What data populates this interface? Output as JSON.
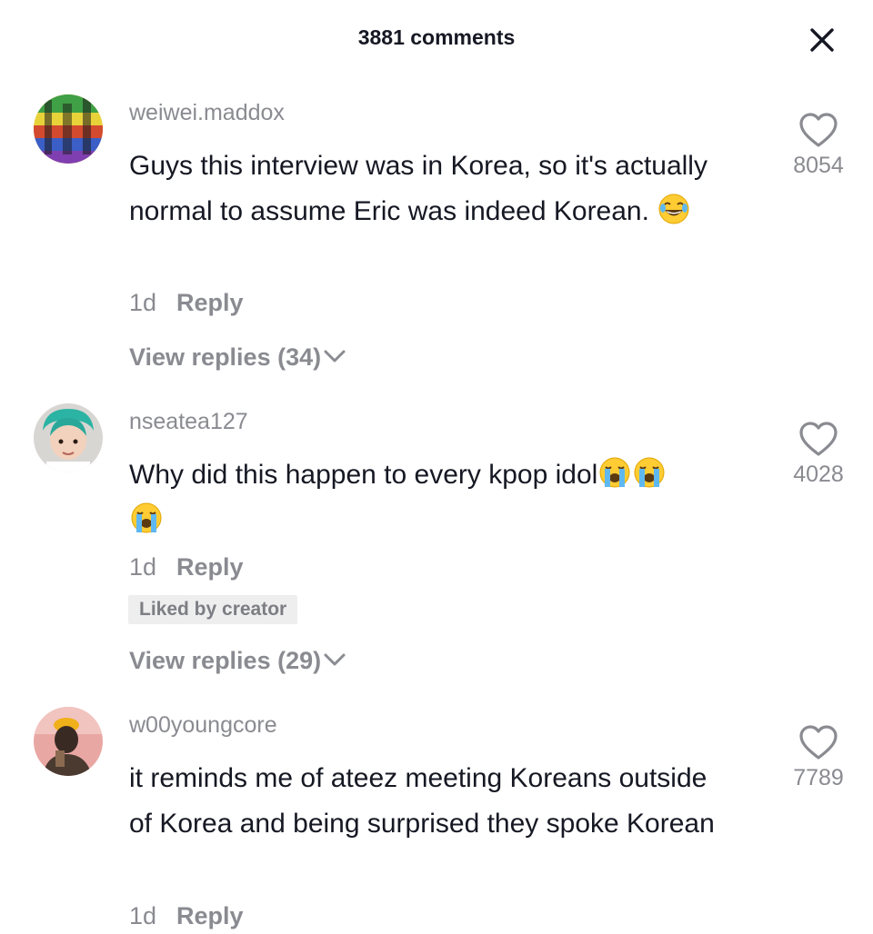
{
  "header": {
    "title": "3881 comments",
    "close_icon": "close-icon"
  },
  "colors": {
    "text_primary": "#161823",
    "text_secondary": "#8a8b91",
    "badge_bg": "#eeeeef"
  },
  "comments": [
    {
      "username": "weiwei.maddox",
      "text_segments": [
        "Guys this interview was in Korea, so it's actually normal to assume Eric was indeed Korean. "
      ],
      "emojis": [
        "tears-of-joy-emoji"
      ],
      "time": "1d",
      "reply_label": "Reply",
      "likes": "8054",
      "view_replies": "View replies (34)"
    },
    {
      "username": "nseatea127",
      "text_segments": [
        "Why did this happen to every kpop idol"
      ],
      "emojis": [
        "loudly-crying-emoji",
        "loudly-crying-emoji",
        "loudly-crying-emoji"
      ],
      "time": "1d",
      "reply_label": "Reply",
      "badge": "Liked by creator",
      "likes": "4028",
      "view_replies": "View replies (29)"
    },
    {
      "username": "w00youngcore",
      "text_segments": [
        "it reminds me of ateez meeting Koreans outside of Korea and being surprised they spoke Korean"
      ],
      "time": "1d",
      "reply_label": "Reply",
      "likes": "7789"
    }
  ]
}
